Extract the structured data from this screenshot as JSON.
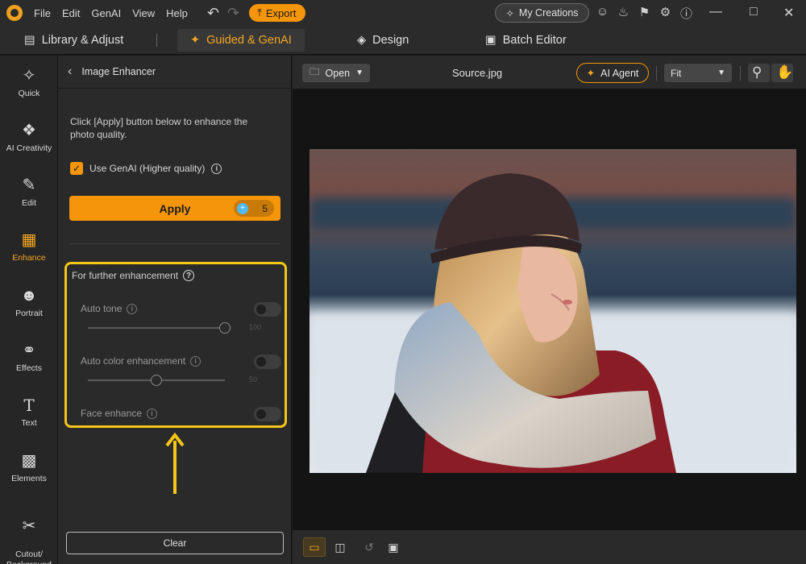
{
  "titlebar": {
    "menu": [
      "File",
      "Edit",
      "GenAI",
      "View",
      "Help"
    ],
    "export_label": "Export",
    "my_creations_label": "My Creations"
  },
  "modes": {
    "library": "Library & Adjust",
    "guided": "Guided & GenAI",
    "design": "Design",
    "batch": "Batch Editor"
  },
  "rail": [
    {
      "label": "Quick",
      "icon": "magic-wand-icon"
    },
    {
      "label": "AI Creativity",
      "icon": "ai-creativity-icon"
    },
    {
      "label": "Edit",
      "icon": "edit-image-icon"
    },
    {
      "label": "Enhance",
      "icon": "enhance-image-icon"
    },
    {
      "label": "Portrait",
      "icon": "portrait-icon"
    },
    {
      "label": "Effects",
      "icon": "effects-icon"
    },
    {
      "label": "Text",
      "icon": "text-icon"
    },
    {
      "label": "Elements",
      "icon": "elements-icon"
    },
    {
      "label": "Cutout/\nBackground",
      "icon": "cutout-icon"
    }
  ],
  "panel": {
    "title": "Image Enhancer",
    "description": "Click [Apply] button below to enhance the photo quality.",
    "use_genai_label": "Use GenAI (Higher quality)",
    "use_genai_checked": true,
    "apply_label": "Apply",
    "credits": "5",
    "further_title": "For further enhancement",
    "auto_tone": {
      "label": "Auto tone",
      "value": "100",
      "enabled": false
    },
    "auto_color": {
      "label": "Auto color enhancement",
      "value": "50",
      "enabled": false
    },
    "face_enhance": {
      "label": "Face enhance",
      "enabled": false
    },
    "clear_label": "Clear"
  },
  "canvas": {
    "open_label": "Open",
    "file_name": "Source.jpg",
    "ai_agent_label": "AI Agent",
    "zoom_mode": "Fit"
  },
  "colors": {
    "accent": "#f5960a",
    "highlight_box": "#f5c518"
  }
}
